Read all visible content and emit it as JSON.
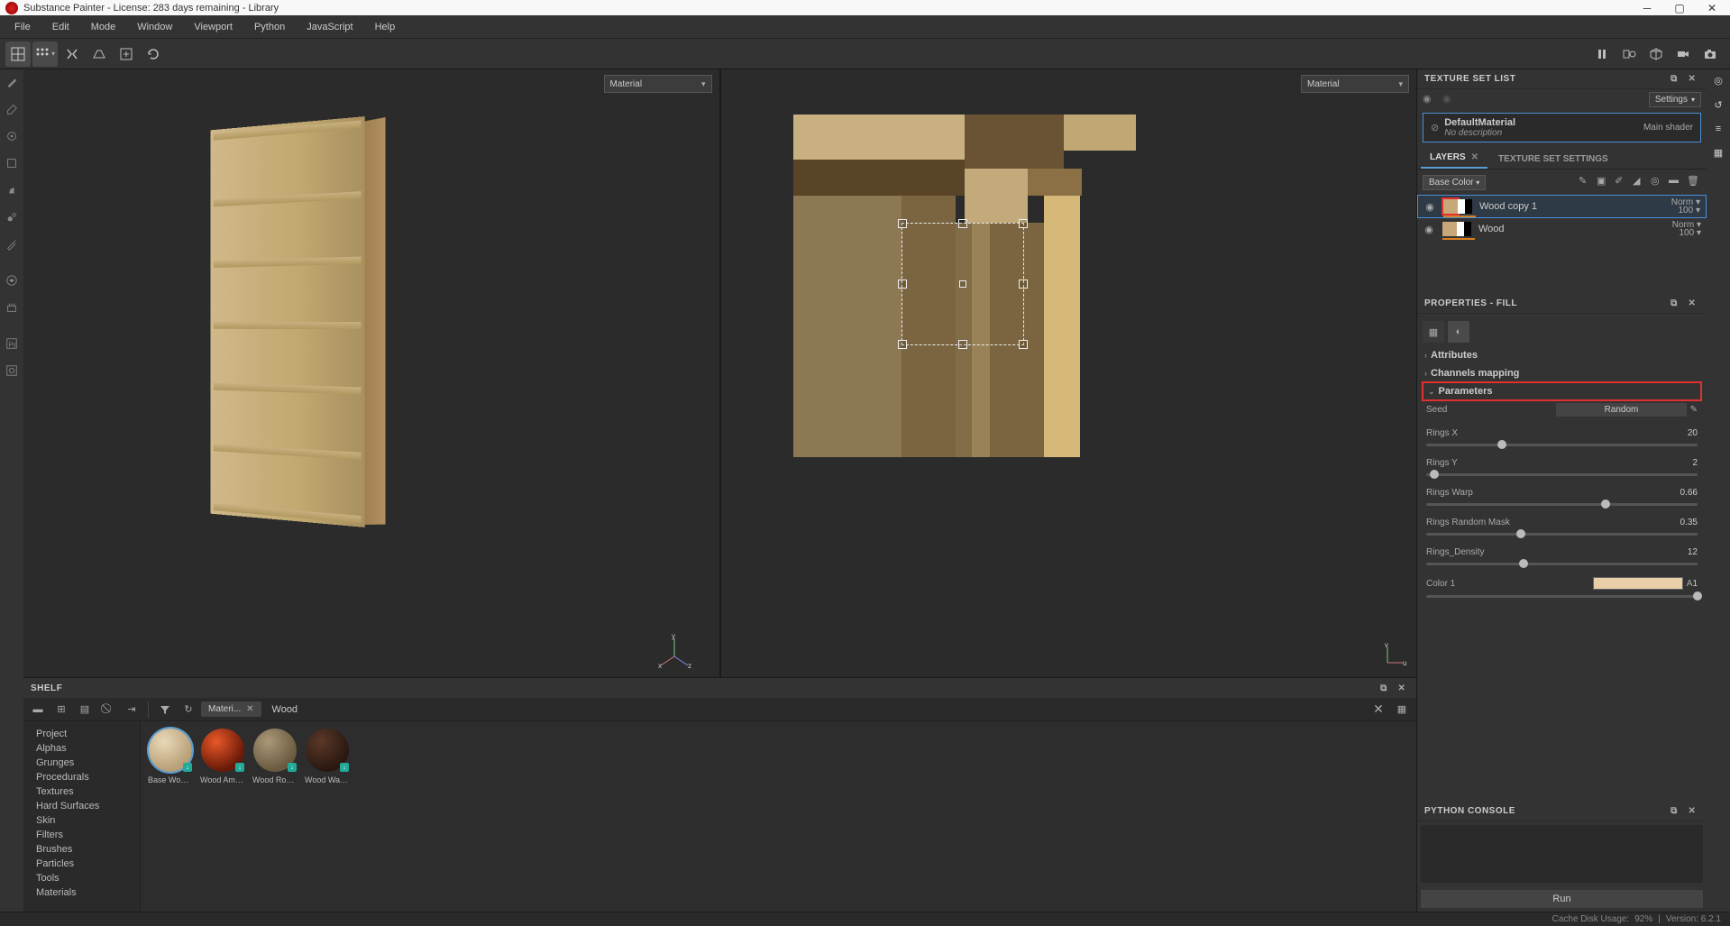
{
  "window": {
    "title": "Substance Painter - License: 283 days remaining - Library"
  },
  "menubar": [
    "File",
    "Edit",
    "Mode",
    "Window",
    "Viewport",
    "Python",
    "JavaScript",
    "Help"
  ],
  "viewport": {
    "dropdown_3d": "Material",
    "dropdown_2d": "Material"
  },
  "texture_set": {
    "title": "TEXTURE SET LIST",
    "settings_btn": "Settings",
    "item_label": "DefaultMaterial",
    "item_sub": "No description",
    "item_shader": "Main shader"
  },
  "layers_panel": {
    "tab_layers": "LAYERS",
    "tab_tss": "TEXTURE SET SETTINGS",
    "channel": "Base Color",
    "layers": [
      {
        "name": "Wood copy 1",
        "blend": "Norm",
        "opacity": "100",
        "selected": true
      },
      {
        "name": "Wood",
        "blend": "Norm",
        "opacity": "100",
        "selected": false
      }
    ]
  },
  "properties": {
    "title": "PROPERTIES - FILL",
    "sec_attributes": "Attributes",
    "sec_channels": "Channels mapping",
    "sec_parameters": "Parameters",
    "params": {
      "seed": {
        "label": "Seed",
        "value": "Random"
      },
      "rings_x": {
        "label": "Rings X",
        "value": "20",
        "pos": 28
      },
      "rings_y": {
        "label": "Rings Y",
        "value": "2",
        "pos": 3
      },
      "rings_warp": {
        "label": "Rings Warp",
        "value": "0.66",
        "pos": 66
      },
      "rings_random_mask": {
        "label": "Rings Random Mask",
        "value": "0.35",
        "pos": 35
      },
      "rings_density": {
        "label": "Rings_Density",
        "value": "12",
        "pos": 36
      },
      "color1": {
        "label": "Color 1",
        "value": "1",
        "pos": 100,
        "a_label": "A"
      }
    }
  },
  "console": {
    "title": "PYTHON CONSOLE",
    "run": "Run"
  },
  "shelf": {
    "title": "SHELF",
    "filter_pill": "Materi...",
    "search_text": "Wood",
    "categories": [
      "Project",
      "Alphas",
      "Grunges",
      "Procedurals",
      "Textures",
      "Hard Surfaces",
      "Skin",
      "Filters",
      "Brushes",
      "Particles",
      "Tools",
      "Materials"
    ],
    "materials": [
      {
        "name": "Base Wood..."
      },
      {
        "name": "Wood Ame..."
      },
      {
        "name": "Wood Rough"
      },
      {
        "name": "Wood Waln..."
      }
    ]
  },
  "statusbar": {
    "cache": "Cache Disk Usage:",
    "cache_val": "92%",
    "version": "Version: 6.2.1"
  }
}
